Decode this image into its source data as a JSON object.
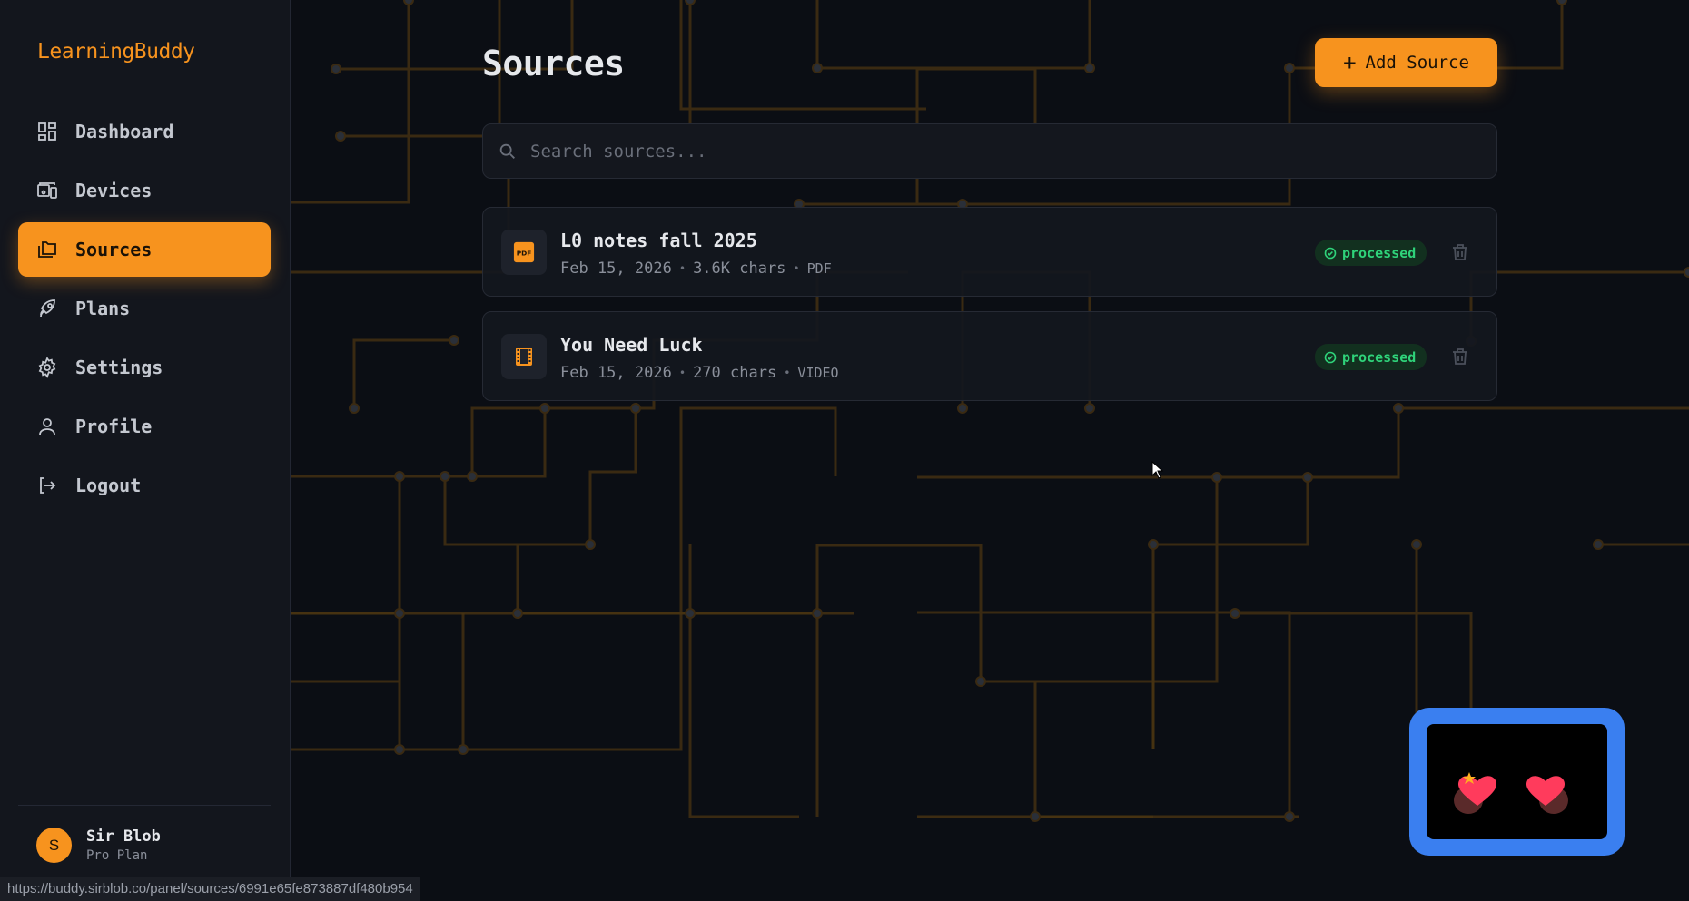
{
  "app": {
    "brand": "LearningBuddy"
  },
  "sidebar": {
    "items": [
      {
        "label": "Dashboard",
        "icon": "dashboard-icon",
        "active": false
      },
      {
        "label": "Devices",
        "icon": "devices-icon",
        "active": false
      },
      {
        "label": "Sources",
        "icon": "folders-icon",
        "active": true
      },
      {
        "label": "Plans",
        "icon": "rocket-icon",
        "active": false
      },
      {
        "label": "Settings",
        "icon": "gear-icon",
        "active": false
      },
      {
        "label": "Profile",
        "icon": "user-icon",
        "active": false
      },
      {
        "label": "Logout",
        "icon": "logout-icon",
        "active": false
      }
    ],
    "user": {
      "initial": "S",
      "name": "Sir Blob",
      "plan": "Pro Plan"
    }
  },
  "main": {
    "title": "Sources",
    "add_button_label": "Add Source",
    "search": {
      "placeholder": "Search sources...",
      "value": ""
    },
    "sources": [
      {
        "title": "L0 notes fall 2025",
        "date": "Feb 15, 2026",
        "size": "3.6K chars",
        "type": "PDF",
        "status": "processed",
        "icon": "pdf-icon"
      },
      {
        "title": "You Need Luck",
        "date": "Feb 15, 2026",
        "size": "270 chars",
        "type": "VIDEO",
        "status": "processed",
        "icon": "film-icon"
      }
    ]
  },
  "status_bar": {
    "url": "https://buddy.sirblob.co/panel/sources/6991e65fe873887df480b954"
  },
  "colors": {
    "accent": "#f7931e",
    "background": "#0b0e14",
    "sidebar": "#13161d",
    "success": "#2fd37a",
    "widget_frame": "#3a7ff0"
  }
}
